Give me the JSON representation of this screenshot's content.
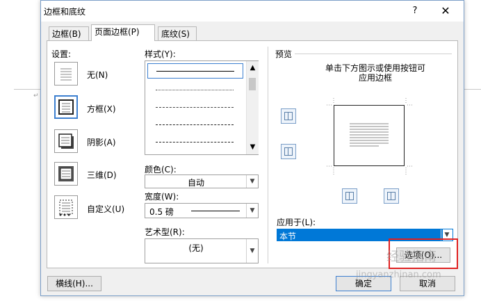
{
  "window": {
    "title": "边框和底纹",
    "help_label": "?",
    "close_label": "✕"
  },
  "tabs": [
    {
      "label": "边框(B)",
      "active": false
    },
    {
      "label": "页面边框(P)",
      "active": true
    },
    {
      "label": "底纹(S)",
      "active": false
    }
  ],
  "setting": {
    "heading": "设置:",
    "options": [
      {
        "label": "无(N)",
        "icon": "none-setting-icon"
      },
      {
        "label": "方框(X)",
        "icon": "box-setting-icon",
        "selected": true
      },
      {
        "label": "阴影(A)",
        "icon": "shadow-setting-icon"
      },
      {
        "label": "三维(D)",
        "icon": "3d-setting-icon"
      },
      {
        "label": "自定义(U)",
        "icon": "custom-setting-icon"
      }
    ]
  },
  "style": {
    "heading": "样式(Y):",
    "items": [
      "solid",
      "dotted",
      "dashed",
      "dash-long",
      "dash-dot"
    ]
  },
  "color": {
    "label": "颜色(C):",
    "value": "自动"
  },
  "width": {
    "label": "宽度(W):",
    "value": "0.5 磅"
  },
  "art": {
    "label": "艺术型(R):",
    "value": "(无)"
  },
  "preview": {
    "heading": "预览",
    "instruction_line1": "单击下方图示或使用按钮可",
    "instruction_line2": "应用边框"
  },
  "apply_to": {
    "label": "应用于(L):",
    "value": "本节"
  },
  "buttons": {
    "options": "选项(O)...",
    "horizontal_line": "横线(H)...",
    "ok": "确定",
    "cancel": "取消"
  },
  "watermark": {
    "text1": "经验指南",
    "text2": "jingyanzhinan.com"
  },
  "colors": {
    "accent": "#3c7fd0",
    "selection": "#0078d7",
    "highlight_box": "#e02020"
  }
}
